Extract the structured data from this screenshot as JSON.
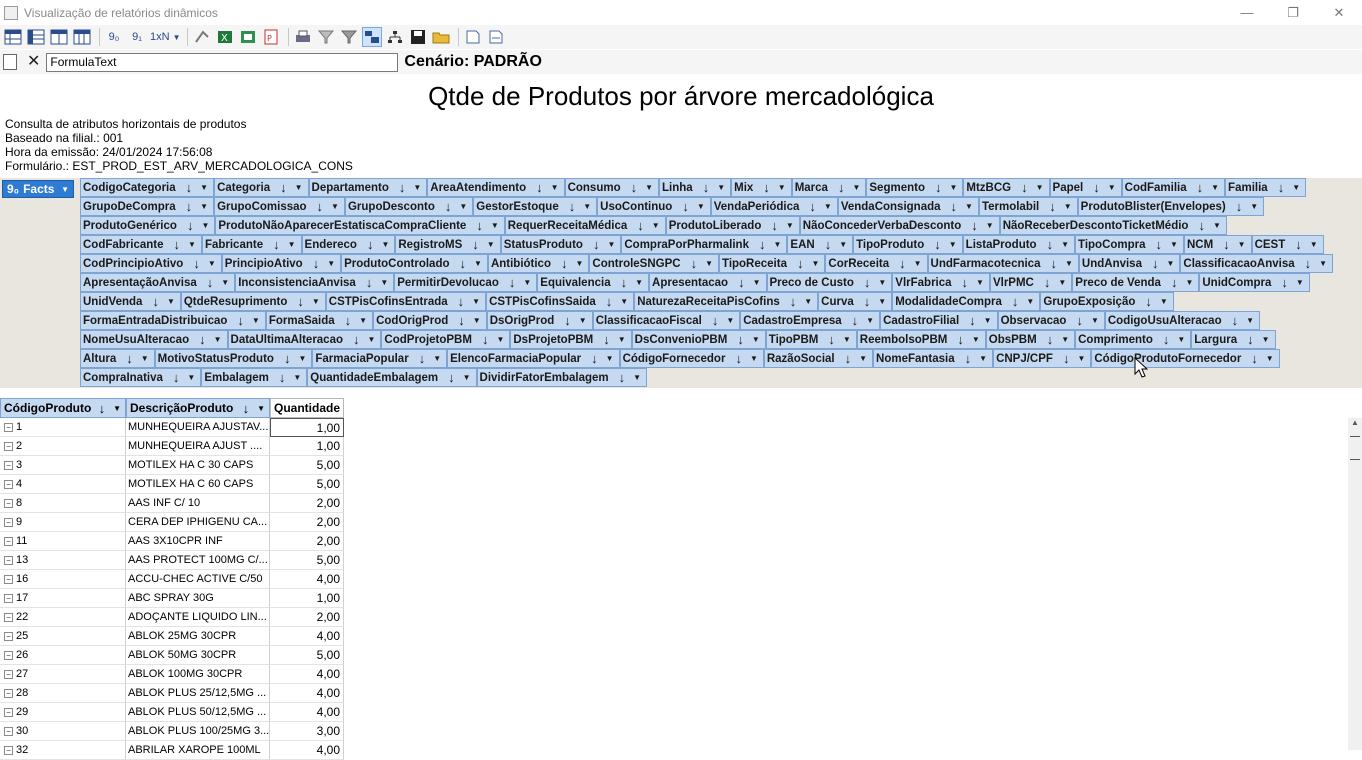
{
  "window": {
    "title": "Visualização de relatórios dinâmicos",
    "min": "—",
    "max": "❐",
    "close": "✕"
  },
  "toolbar": {
    "btn_90": "9₀",
    "btn_91": "9₁",
    "btn_1xN": "1xN"
  },
  "formula": {
    "value": "FormulaText",
    "scenario": "Cenário: PADRÃO"
  },
  "report": {
    "title": "Qtde de Produtos por árvore mercadológica",
    "info": [
      "Consulta de atributos horizontais de produtos",
      "Baseado na filial.: 001",
      "Hora da emissão: 24/01/2024 17:56:08",
      "Formulário.: EST_PROD_EST_ARV_MERCADOLOGICA_CONS"
    ]
  },
  "facts_label": "Facts",
  "field_rows": [
    [
      "CodigoCategoria",
      "Categoria",
      "Departamento",
      "AreaAtendimento",
      "Consumo",
      "Linha",
      "Mix",
      "Marca",
      "Segmento",
      "MtzBCG",
      "Papel",
      "CodFamilia",
      "Familia"
    ],
    [
      "GrupoDeCompra",
      "GrupoComissao",
      "GrupoDesconto",
      "GestorEstoque",
      "UsoContinuo",
      "VendaPeriódica",
      "VendaConsignada",
      "Termolabil",
      "ProdutoBlister(Envelopes)"
    ],
    [
      "ProdutoGenérico",
      "ProdutoNãoAparecerEstatiscaCompraCliente",
      "RequerReceitaMédica",
      "ProdutoLiberado",
      "NãoConcederVerbaDesconto",
      "NãoReceberDescontoTicketMédio"
    ],
    [
      "CodFabricante",
      "Fabricante",
      "Endereco",
      "RegistroMS",
      "StatusProduto",
      "CompraPorPharmalink",
      "EAN",
      "TipoProduto",
      "ListaProduto",
      "TipoCompra",
      "NCM",
      "CEST"
    ],
    [
      "CodPrincipioAtivo",
      "PrincipioAtivo",
      "ProdutoControlado",
      "Antibiótico",
      "ControleSNGPC",
      "TipoReceita",
      "CorReceita",
      "UndFarmacotecnica",
      "UndAnvisa",
      "ClassificacaoAnvisa"
    ],
    [
      "ApresentaçãoAnvisa",
      "InconsistenciaAnvisa",
      "PermitirDevolucao",
      "Equivalencia",
      "Apresentacao",
      "Preco de Custo",
      "VlrFabrica",
      "VlrPMC",
      "Preco de Venda",
      "UnidCompra"
    ],
    [
      "UnidVenda",
      "QtdeResuprimento",
      "CSTPisCofinsEntrada",
      "CSTPisCofinsSaida",
      "NaturezaReceitaPisCofins",
      "Curva",
      "ModalidadeCompra",
      "GrupoExposição"
    ],
    [
      "FormaEntradaDistribuicao",
      "FormaSaida",
      "CodOrigProd",
      "DsOrigProd",
      "ClassificacaoFiscal",
      "CadastroEmpresa",
      "CadastroFilial",
      "Observacao",
      "CodigoUsuAlteracao"
    ],
    [
      "NomeUsuAlteracao",
      "DataUltimaAlteracao",
      "CodProjetoPBM",
      "DsProjetoPBM",
      "DsConvenioPBM",
      "TipoPBM",
      "ReembolsoPBM",
      "ObsPBM",
      "Comprimento",
      "Largura"
    ],
    [
      "Altura",
      "MotivoStatusProduto",
      "FarmaciaPopular",
      "ElencoFarmaciaPopular",
      "CódigoFornecedor",
      "RazãoSocial",
      "NomeFantasia",
      "CNPJ/CPF",
      "CódigoProdutoFornecedor"
    ],
    [
      "CompraInativa",
      "Embalagem",
      "QuantidadeEmbalagem",
      "DividirFatorEmbalagem"
    ]
  ],
  "grid": {
    "headers": [
      "CódigoProduto",
      "DescriçãoProduto",
      "Quantidade"
    ],
    "rows": [
      {
        "code": "1",
        "desc": "MUNHEQUEIRA  AJUSTAV...",
        "qty": "1,00"
      },
      {
        "code": "2",
        "desc": "MUNHEQUEIRA  AJUST ....",
        "qty": "1,00"
      },
      {
        "code": "3",
        "desc": "MOTILEX HA C 30 CAPS",
        "qty": "5,00"
      },
      {
        "code": "4",
        "desc": "MOTILEX HA C 60 CAPS",
        "qty": "5,00"
      },
      {
        "code": "8",
        "desc": "AAS INF C/ 10",
        "qty": "2,00"
      },
      {
        "code": "9",
        "desc": "CERA  DEP IPHIGENU CA...",
        "qty": "2,00"
      },
      {
        "code": "11",
        "desc": "AAS 3X10CPR INF",
        "qty": "2,00"
      },
      {
        "code": "13",
        "desc": "AAS PROTECT 100MG C/...",
        "qty": "5,00"
      },
      {
        "code": "16",
        "desc": "ACCU-CHEC  ACTIVE C/50",
        "qty": "4,00"
      },
      {
        "code": "17",
        "desc": "ABC SPRAY 30G",
        "qty": "1,00"
      },
      {
        "code": "22",
        "desc": "ADOÇANTE LIQUIDO LIN...",
        "qty": "2,00"
      },
      {
        "code": "25",
        "desc": "ABLOK  25MG 30CPR",
        "qty": "4,00"
      },
      {
        "code": "26",
        "desc": "ABLOK  50MG 30CPR",
        "qty": "5,00"
      },
      {
        "code": "27",
        "desc": "ABLOK 100MG 30CPR",
        "qty": "4,00"
      },
      {
        "code": "28",
        "desc": "ABLOK PLUS  25/12,5MG ...",
        "qty": "4,00"
      },
      {
        "code": "29",
        "desc": "ABLOK PLUS  50/12,5MG ...",
        "qty": "4,00"
      },
      {
        "code": "30",
        "desc": "ABLOK PLUS 100/25MG 3...",
        "qty": "3,00"
      },
      {
        "code": "32",
        "desc": "ABRILAR XAROPE 100ML",
        "qty": "4,00"
      }
    ]
  }
}
